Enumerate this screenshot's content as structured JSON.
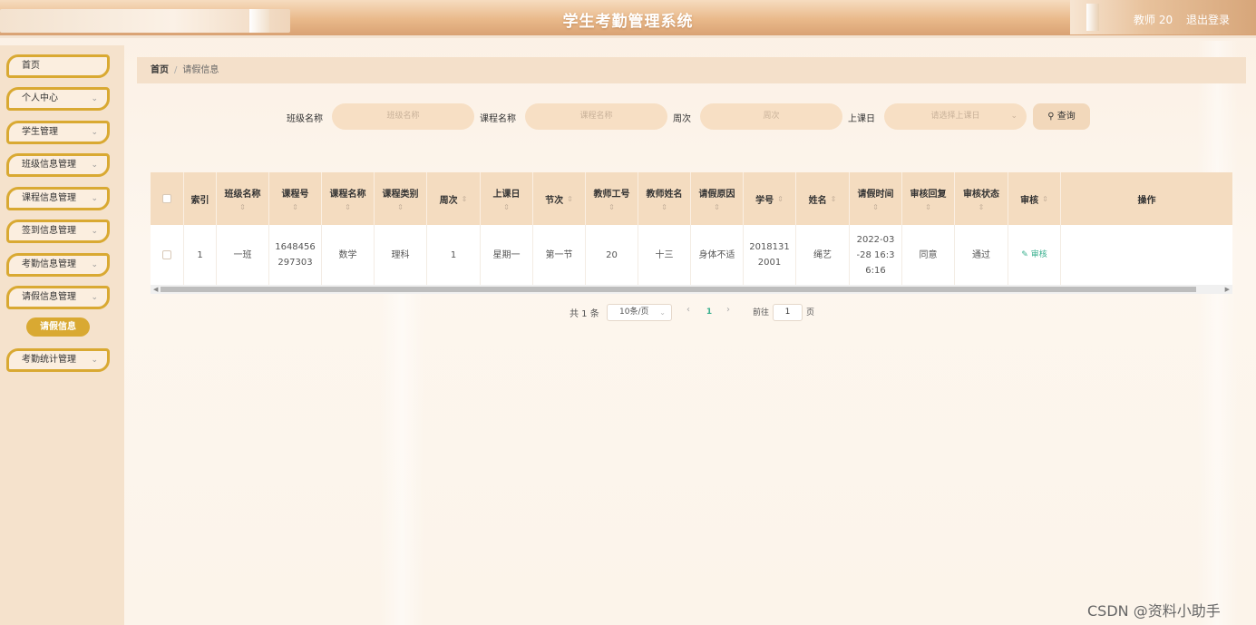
{
  "header": {
    "title": "学生考勤管理系统",
    "user": "教师 20",
    "logout": "退出登录"
  },
  "sidebar": {
    "items": [
      {
        "label": "首页",
        "has_children": false
      },
      {
        "label": "个人中心",
        "has_children": true
      },
      {
        "label": "学生管理",
        "has_children": true
      },
      {
        "label": "班级信息管理",
        "has_children": true
      },
      {
        "label": "课程信息管理",
        "has_children": true
      },
      {
        "label": "签到信息管理",
        "has_children": true
      },
      {
        "label": "考勤信息管理",
        "has_children": true
      },
      {
        "label": "请假信息管理",
        "has_children": true
      },
      {
        "label": "考勤统计管理",
        "has_children": true
      }
    ],
    "active_sub": "请假信息",
    "chevron": "chevron-down-icon"
  },
  "breadcrumb": {
    "home": "首页",
    "separator": "/",
    "current": "请假信息"
  },
  "search": {
    "class_label": "班级名称",
    "class_placeholder": "班级名称",
    "course_label": "课程名称",
    "course_placeholder": "课程名称",
    "week_label": "周次",
    "week_placeholder": "周次",
    "day_label": "上课日",
    "day_placeholder": "请选择上课日",
    "query_button": "查询"
  },
  "table": {
    "headers": [
      "",
      "索引",
      "班级名称",
      "课程号",
      "课程名称",
      "课程类别",
      "周次",
      "上课日",
      "节次",
      "教师工号",
      "教师姓名",
      "请假原因",
      "学号",
      "姓名",
      "请假时间",
      "审核回复",
      "审核状态",
      "审核",
      "操作"
    ],
    "rows": [
      {
        "index": "1",
        "class_name": "一班",
        "course_no": "1648456\n297303",
        "course_name": "数学",
        "course_type": "理科",
        "week": "1",
        "day": "星期一",
        "section": "第一节",
        "teacher_no": "20",
        "teacher_name": "十三",
        "reason": "身体不适",
        "student_no": "2018131\n2001",
        "student_name": "绳艺",
        "leave_time": "2022-03\n-28 16:3\n6:16",
        "reply": "同意",
        "status": "通过",
        "audit": "审核"
      }
    ]
  },
  "pagination": {
    "total": "共 1 条",
    "page_size": "10条/页",
    "current_page": "1",
    "goto_label": "前往",
    "goto_value": "1",
    "unit": "页"
  },
  "watermark": "CSDN @资料小助手",
  "colors": {
    "accent": "#d9a932",
    "link": "#3bb08f",
    "header_bg": "#e9b98a"
  }
}
